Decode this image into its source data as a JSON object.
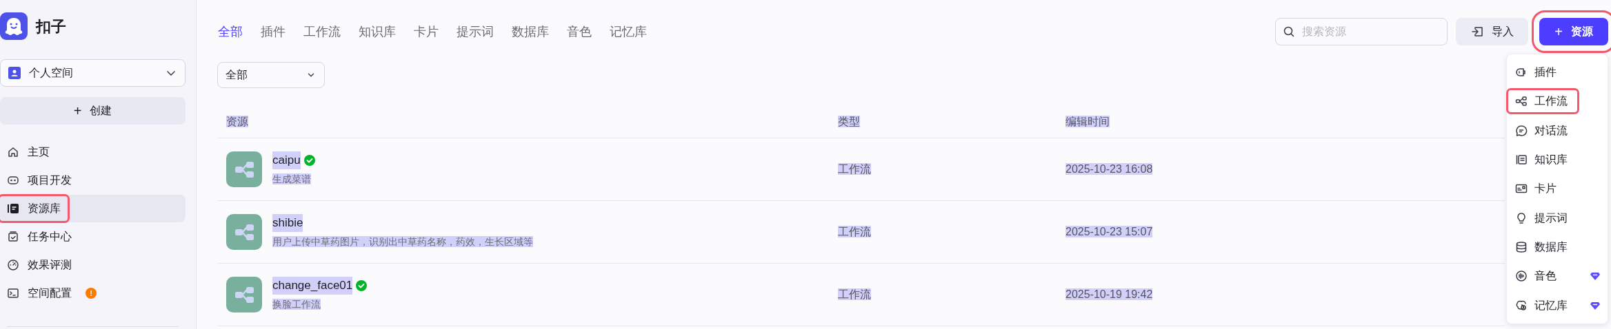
{
  "app": {
    "name": "扣子"
  },
  "space_selector": {
    "label": "个人空间"
  },
  "create_button": {
    "label": "创建",
    "icon": "+"
  },
  "nav": [
    {
      "label": "主页",
      "selected": false,
      "highlighted": false
    },
    {
      "label": "项目开发",
      "selected": false,
      "highlighted": false
    },
    {
      "label": "资源库",
      "selected": true,
      "highlighted": true
    },
    {
      "label": "任务中心",
      "selected": false,
      "highlighted": false
    },
    {
      "label": "效果评测",
      "selected": false,
      "highlighted": false
    },
    {
      "label": "空间配置",
      "selected": false,
      "highlighted": false,
      "badge": "!"
    }
  ],
  "tabs": [
    {
      "label": "全部",
      "selected": true
    },
    {
      "label": "插件",
      "selected": false
    },
    {
      "label": "工作流",
      "selected": false
    },
    {
      "label": "知识库",
      "selected": false
    },
    {
      "label": "卡片",
      "selected": false
    },
    {
      "label": "提示词",
      "selected": false
    },
    {
      "label": "数据库",
      "selected": false
    },
    {
      "label": "音色",
      "selected": false
    },
    {
      "label": "记忆库",
      "selected": false
    }
  ],
  "filter": {
    "value": "全部"
  },
  "search": {
    "placeholder": "搜索资源"
  },
  "import_button": {
    "label": "导入"
  },
  "add_resource_button": {
    "label": "资源",
    "icon": "+",
    "highlighted": true
  },
  "add_menu": [
    {
      "label": "插件",
      "highlighted": false,
      "premium": false
    },
    {
      "label": "工作流",
      "highlighted": true,
      "premium": false
    },
    {
      "label": "对话流",
      "highlighted": false,
      "premium": false
    },
    {
      "label": "知识库",
      "highlighted": false,
      "premium": false
    },
    {
      "label": "卡片",
      "highlighted": false,
      "premium": false
    },
    {
      "label": "提示词",
      "highlighted": false,
      "premium": false
    },
    {
      "label": "数据库",
      "highlighted": false,
      "premium": false
    },
    {
      "label": "音色",
      "highlighted": false,
      "premium": true
    },
    {
      "label": "记忆库",
      "highlighted": false,
      "premium": true
    }
  ],
  "table": {
    "text_selected": true,
    "columns": [
      "资源",
      "类型",
      "编辑时间"
    ],
    "rows": [
      {
        "name": "caipu",
        "published": true,
        "description": "生成菜谱",
        "type": "工作流",
        "edited": "2025-10-23 16:08"
      },
      {
        "name": "shibie",
        "published": false,
        "description": "用户上传中草药图片，识别出中草药名称，药效，生长区域等",
        "type": "工作流",
        "edited": "2025-10-23 15:07"
      },
      {
        "name": "change_face01",
        "published": true,
        "description": "换脸工作流",
        "type": "工作流",
        "edited": "2025-10-19 19:42"
      }
    ]
  }
}
